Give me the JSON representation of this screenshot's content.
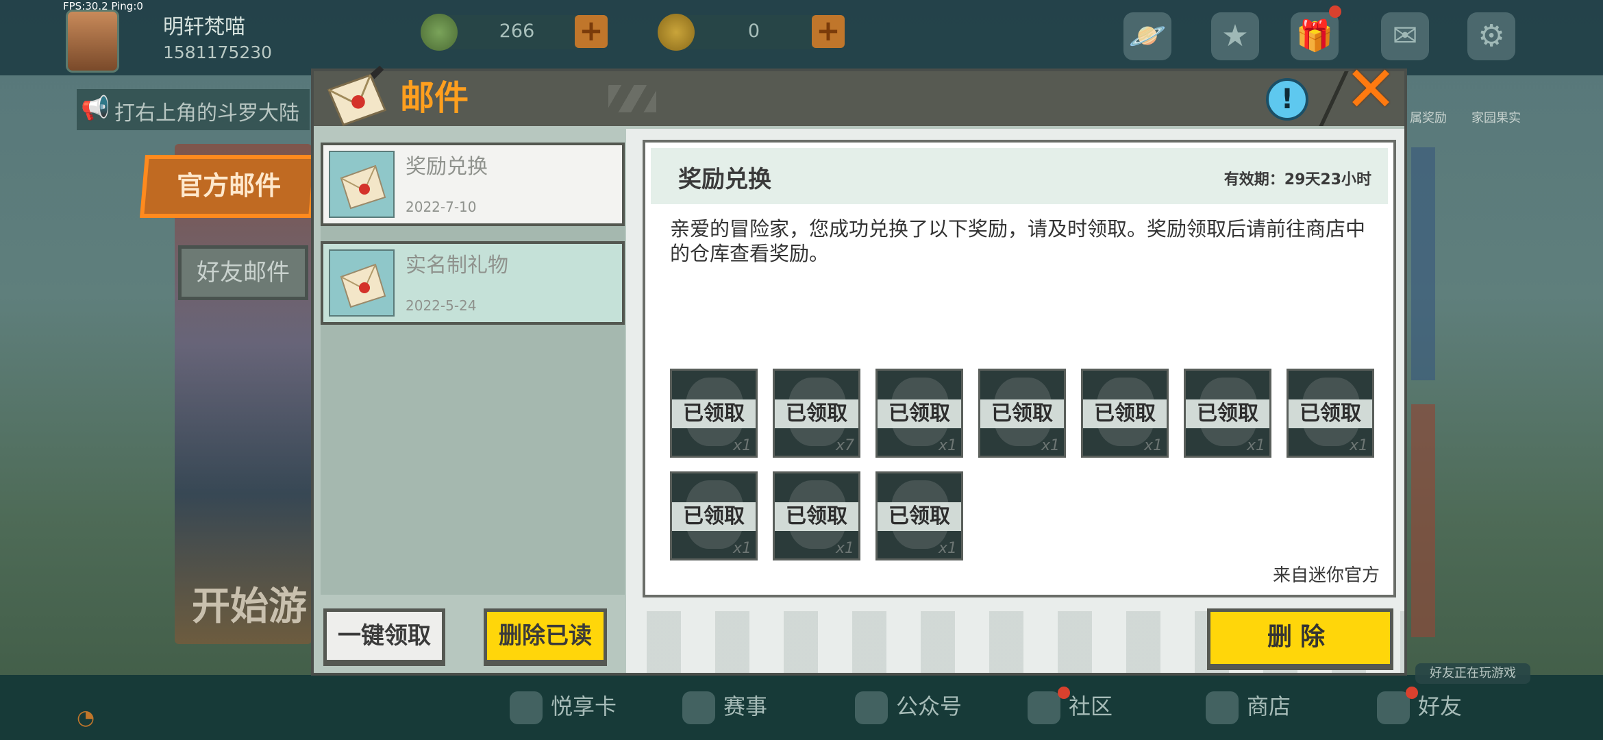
{
  "hud": {
    "fps": "FPS:30.2  Ping:0",
    "username": "明轩梵喵",
    "user_id": "1581175230",
    "gems": "266",
    "coins": "0",
    "notice": "打右上角的斗罗大陆",
    "top_right_labels": [
      "属奖励",
      "家园果实"
    ],
    "start_game": "开始游",
    "friend_playing": "好友正在玩游戏",
    "bottom_nav": [
      "悦享卡",
      "赛事",
      "公众号",
      "社区",
      "商店",
      "好友"
    ]
  },
  "tabs": {
    "official": "官方邮件",
    "friend": "好友邮件"
  },
  "dialog": {
    "title": "邮件",
    "mails": [
      {
        "title": "奖励兑换",
        "date": "2022-7-10"
      },
      {
        "title": "实名制礼物",
        "date": "2022-5-24"
      }
    ],
    "claim_all": "一键领取",
    "delete_read": "删除已读",
    "delete": "删除"
  },
  "detail": {
    "title": "奖励兑换",
    "validity": "有效期：29天23小时",
    "body": "亲爱的冒险家，您成功兑换了以下奖励，请及时领取。奖励领取后请前往商店中的仓库查看奖励。",
    "from": "来自迷你官方",
    "rewards": [
      {
        "status": "已领取",
        "qty": "x1"
      },
      {
        "status": "已领取",
        "qty": "x7"
      },
      {
        "status": "已领取",
        "qty": "x1"
      },
      {
        "status": "已领取",
        "qty": "x1"
      },
      {
        "status": "已领取",
        "qty": "x1"
      },
      {
        "status": "已领取",
        "qty": "x1"
      },
      {
        "status": "已领取",
        "qty": "x1"
      },
      {
        "status": "已领取",
        "qty": "x1"
      },
      {
        "status": "已领取",
        "qty": "x1"
      },
      {
        "status": "已领取",
        "qty": "x1"
      }
    ]
  },
  "colors": {
    "accent_orange": "#ff9f1e",
    "button_yellow": "#ffd60a",
    "info_blue": "#5ec8ef"
  }
}
